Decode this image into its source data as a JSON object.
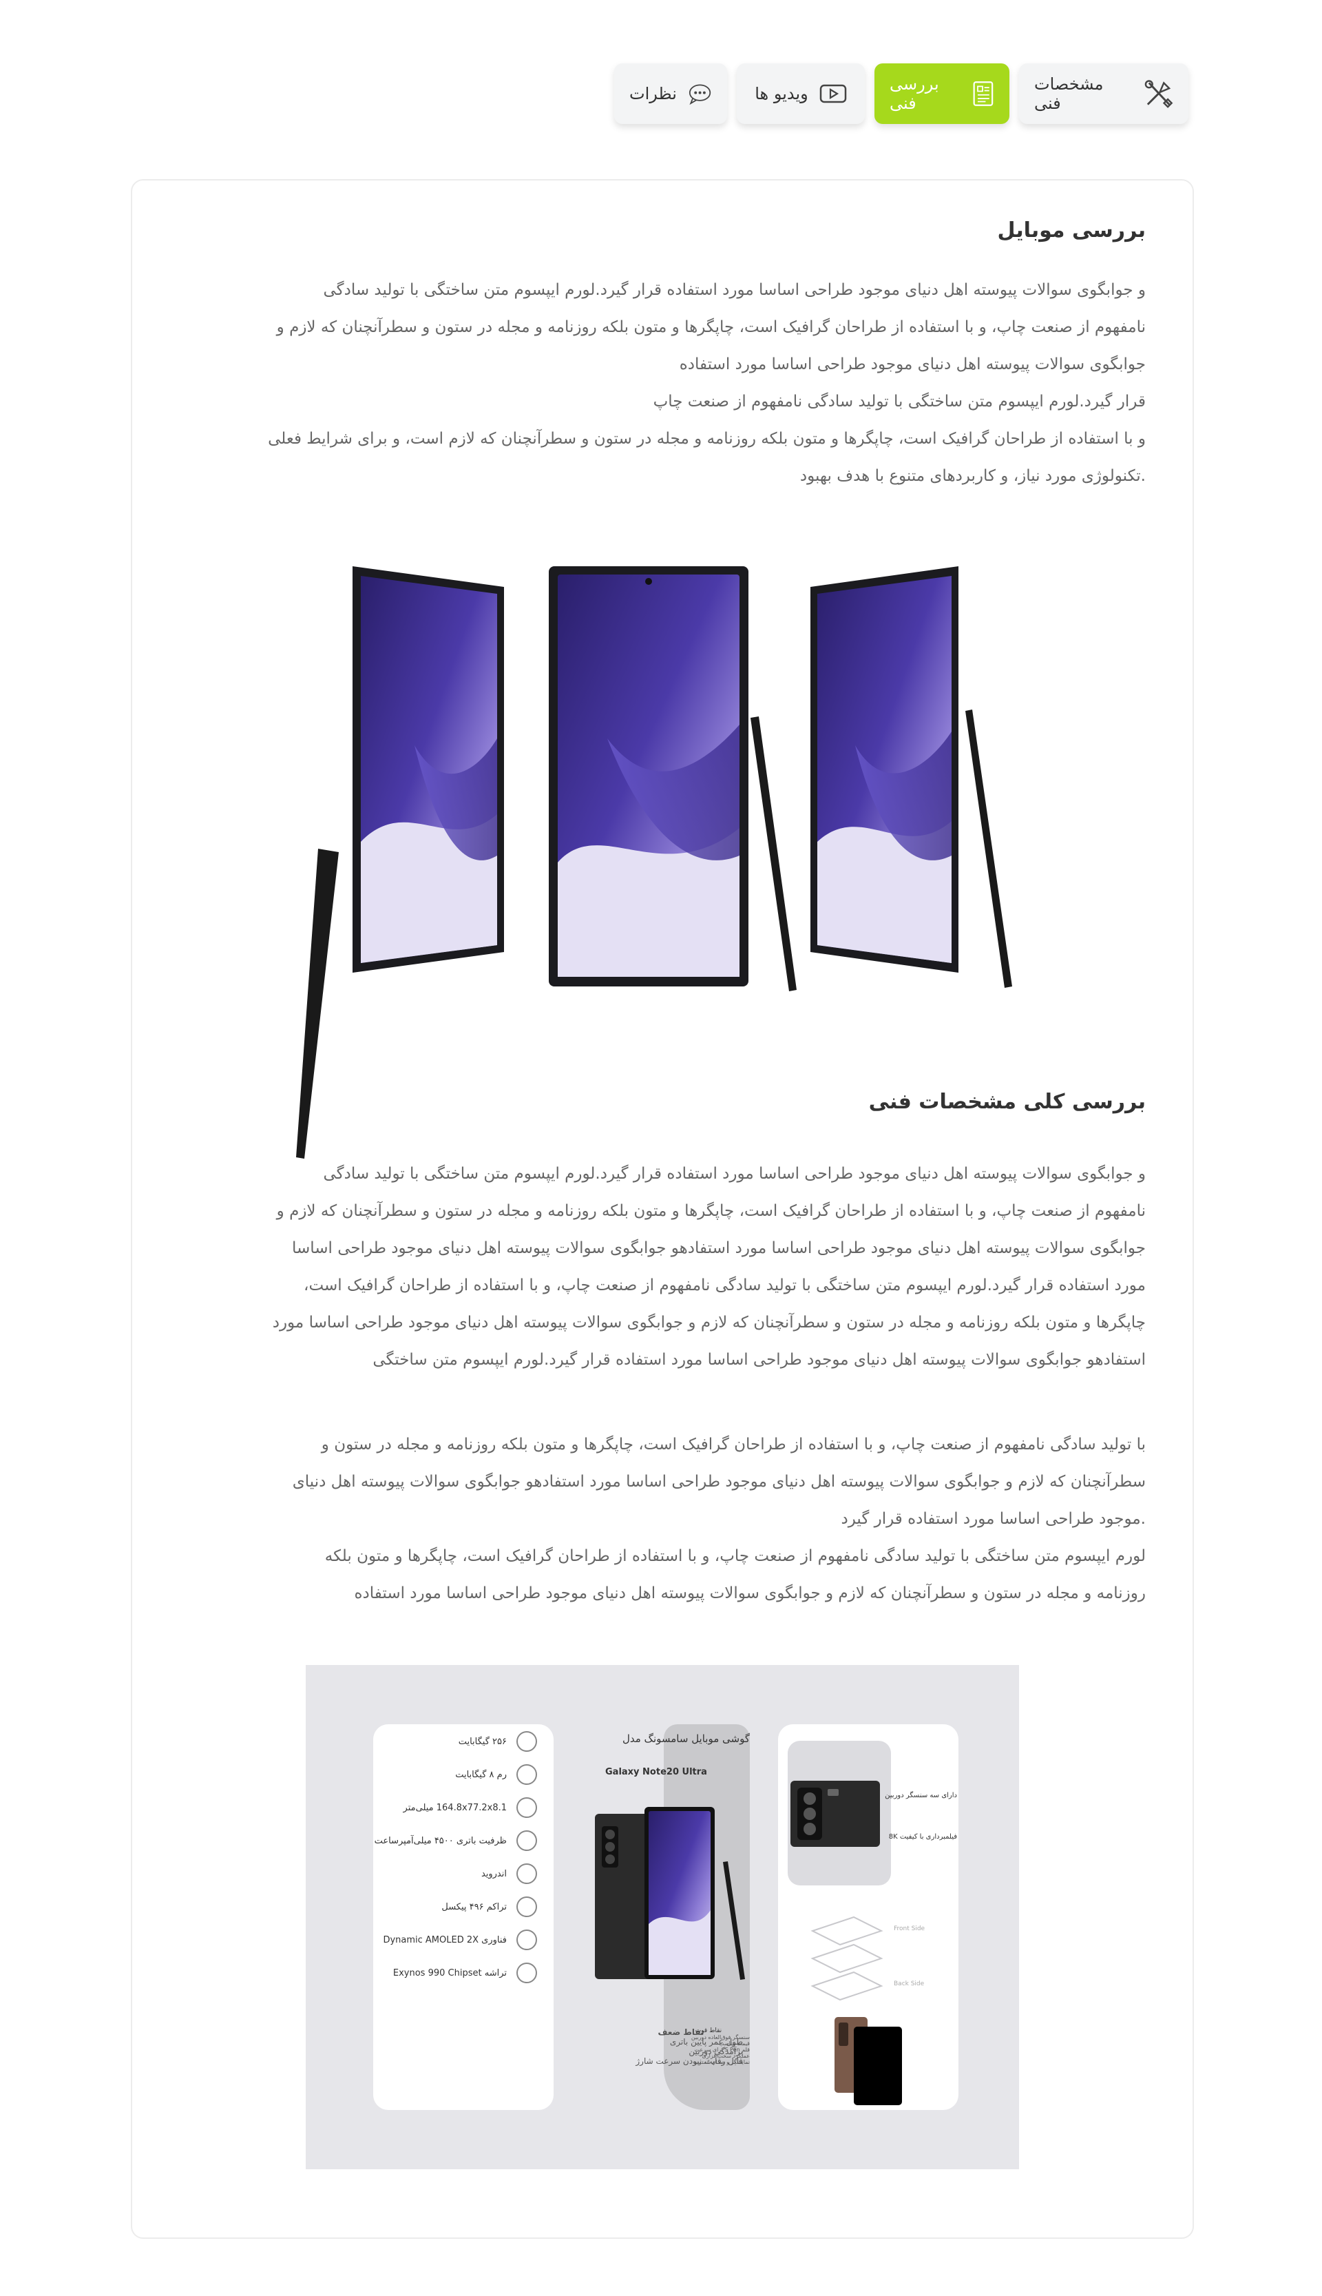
{
  "tabs": [
    {
      "label": "مشخصات فنی",
      "icon": "tools-icon",
      "active": false
    },
    {
      "label": "بررسی فنی",
      "icon": "document-icon",
      "active": true
    },
    {
      "label": "ویدیو ها",
      "icon": "video-icon",
      "active": false
    },
    {
      "label": "نظرات",
      "icon": "comment-icon",
      "active": false
    }
  ],
  "colors": {
    "accent": "#a6d91c",
    "tab_bg": "#f3f4f5",
    "text": "#333333",
    "muted": "#666666"
  },
  "section1": {
    "title": "بررسی موبایل",
    "lines": [
      "و جوابگوی سوالات پیوسته اهل دنیای موجود طراحی اساسا مورد استفاده قرار گیرد.لورم ایپسوم متن ساختگی با تولید سادگی",
      "نامفهوم از صنعت چاپ، و با استفاده از طراحان گرافیک است، چاپگرها و متون بلکه روزنامه و مجله در ستون و سطرآنچنان که لازم و",
      "جوابگوی سوالات پیوسته اهل دنیای موجود طراحی اساسا مورد استفاده",
      "قرار گیرد.لورم ایپسوم متن ساختگی با تولید سادگی نامفهوم از صنعت چاپ",
      "و با استفاده از طراحان گرافیک است، چاپگرها و متون بلکه روزنامه و مجله در ستون و سطرآنچنان که لازم است، و برای شرایط فعلی",
      ".تکنولوژی مورد نیاز، و کاربردهای متنوع با هدف بهبود"
    ]
  },
  "section2": {
    "title": "بررسی کلی مشخصات فنی",
    "para1": [
      "و جوابگوی سوالات پیوسته اهل دنیای موجود طراحی اساسا مورد استفاده قرار گیرد.لورم ایپسوم متن ساختگی با تولید سادگی",
      "نامفهوم از صنعت چاپ، و با استفاده از طراحان گرافیک است، چاپگرها و متون بلکه روزنامه و مجله در ستون و سطرآنچنان که لازم و",
      "جوابگوی سوالات پیوسته اهل دنیای موجود طراحی اساسا مورد استفادهو جوابگوی سوالات پیوسته اهل دنیای موجود طراحی اساسا",
      "مورد استفاده قرار گیرد.لورم ایپسوم متن ساختگی با تولید سادگی نامفهوم از صنعت چاپ، و با استفاده از طراحان گرافیک است،",
      "چاپگرها و متون بلکه روزنامه و مجله در ستون و سطرآنچنان که لازم و جوابگوی سوالات پیوسته اهل دنیای موجود طراحی اساسا مورد",
      "استفادهو جوابگوی سوالات پیوسته اهل دنیای موجود طراحی اساسا مورد استفاده قرار گیرد.لورم ایپسوم متن ساختگی"
    ],
    "para2": [
      "با تولید سادگی نامفهوم از صنعت چاپ، و با استفاده از طراحان گرافیک است، چاپگرها و متون بلکه روزنامه و مجله در ستون و",
      "سطرآنچنان که لازم و جوابگوی سوالات پیوسته اهل دنیای موجود طراحی اساسا مورد استفادهو جوابگوی سوالات پیوسته اهل دنیای",
      ".موجود طراحی اساسا مورد استفاده قرار گیرد",
      "لورم ایپسوم متن ساختگی با تولید سادگی نامفهوم از صنعت چاپ، و با استفاده از طراحان گرافیک است، چاپگرها و متون بلکه",
      "روزنامه و مجله در ستون و سطرآنچنان که لازم و جوابگوی سوالات پیوسته اهل دنیای موجود طراحی اساسا مورد استفاده"
    ]
  },
  "infographic": {
    "title": "گوشی موبایل سامسونگ مدل",
    "model": "Galaxy Note20 Ultra",
    "specs": [
      {
        "text": "۲۵۶ گیگابایت",
        "icon": "storage-icon"
      },
      {
        "text": "رم ۸ گیگابایت",
        "icon": "ram-icon"
      },
      {
        "text": "164.8x77.2x8.1 میلی‌متر",
        "icon": "dimensions-icon"
      },
      {
        "text": "ظرفیت باتری ۴۵۰۰ میلی‌آمپرساعت",
        "icon": "battery-icon"
      },
      {
        "text": "اندروید",
        "icon": "android-icon"
      },
      {
        "text": "تراکم ۴۹۶ پیکسل",
        "icon": "pixel-density-icon"
      },
      {
        "text": "فناوری Dynamic AMOLED 2X",
        "icon": "display-icon"
      },
      {
        "text": "تراشه Exynos 990 Chipset",
        "icon": "chip-icon"
      }
    ],
    "camera_labels": [
      "دارای سه سنسگر دوربین",
      "فیلمبرداری با کیفیت 8K"
    ],
    "side_labels": [
      "Front Side",
      "Back Side"
    ],
    "weak_points_title": "نقاط ضعف",
    "weak_points": [
      "طول عمر پایین باتری",
      "برآمدگی دوربین",
      "قابل رقابت نبودن سرعت شارژ"
    ],
    "strong_points_title": "نقاط قوت",
    "strong_points": [
      "سنسگر فوق‌العاده دوربین",
      "قیمت مناسب",
      "قلم S Pen برای سرعت",
      "عملکرد سخت‌افزاری",
      "نمایشگر و صدای استریو"
    ]
  }
}
